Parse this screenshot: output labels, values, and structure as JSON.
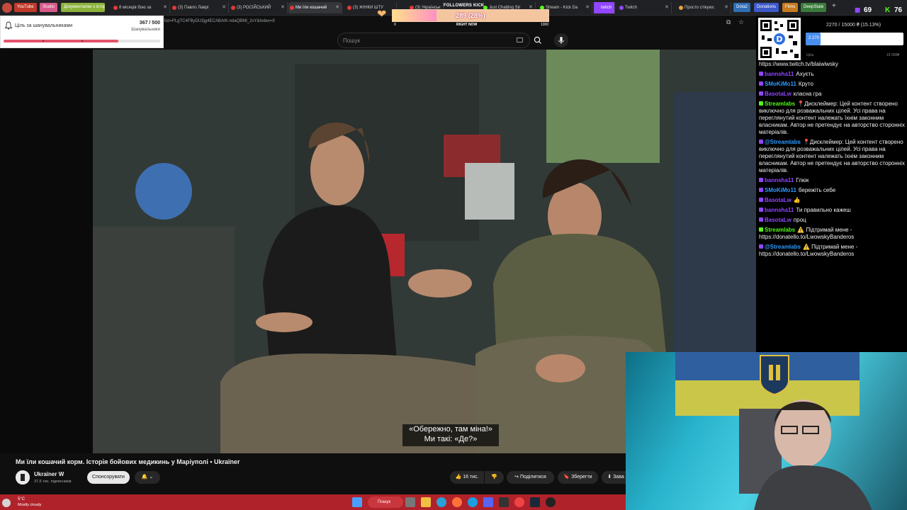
{
  "browser": {
    "bookmarks": [
      {
        "label": "YouTube",
        "color": "#c0392b"
      },
      {
        "label": "Studio",
        "color": "#d65a8a"
      },
      {
        "label": "Документалки з історії",
        "color": "#8bb23a"
      }
    ],
    "tabs": [
      {
        "label": "8 місяців бою за"
      },
      {
        "label": "(3) Павло Лаврі"
      },
      {
        "label": "(3) РОСІЙСЬКИЙ"
      },
      {
        "label": "Ми їли кошачий",
        "active": true
      },
      {
        "label": "(3) ЖІНКИ ШТУ"
      },
      {
        "label": "(3) Українськ"
      },
      {
        "label": "Just Chatting Str"
      },
      {
        "label": "Stream - Kick Da"
      },
      {
        "label": "twitch"
      },
      {
        "label": "Twitch"
      },
      {
        "label": "Просто стікуюс"
      },
      {
        "label": "Dota2"
      },
      {
        "label": "Donations"
      },
      {
        "label": "Films"
      },
      {
        "label": "DeepState"
      }
    ],
    "url": "list=PLgTC4FByDU3jg4ECABAIK-ndaQBMt_2sY&index=9",
    "viewers_left": "69",
    "viewers_right": "76"
  },
  "follower_goal": {
    "title": "Ціль за шанувальниками",
    "count": "367 / 500",
    "subtitle": "Шанувальники",
    "progress": 0.734
  },
  "kick_widget": {
    "label": "FOLLOWERS KICK",
    "value": "289 (28%)",
    "min": "0",
    "now": "RIGHT NOW",
    "max": "1000",
    "progress": 0.28
  },
  "youtube": {
    "search_placeholder": "Пошук",
    "subtitle_lines": [
      "«Обережно, там міна!»",
      "Ми такі: «Де?»"
    ],
    "video_title": "Ми їли кошачий корм. Історія бойових медикинь у Маріуполі • Ukraїner",
    "channel_name": "Ukraїner W",
    "channel_subs": "37,6 тис. підписників",
    "sponsor_label": "Спонсорувати",
    "likes": "16 тис.",
    "share_label": "Поділитися",
    "save_label": "Зберегти",
    "download_label": "Зава"
  },
  "donation_goal": {
    "text": "2270 / 15000 ₴ (15.13%)",
    "bar_label": "2 270",
    "min_label": "Ціль",
    "max_label": "15 000₴",
    "progress": 0.1513
  },
  "chat": {
    "messages": [
      {
        "user": "",
        "color": "#ffffff",
        "text": "https://www.twitch.tv/blaiwiwsky"
      },
      {
        "user": "bannsha11",
        "color": "#9146ff",
        "text": "Ахуєть"
      },
      {
        "user": "SMoKiMo11",
        "color": "#2e9bff",
        "text": "Круто"
      },
      {
        "user": "BasotaLw",
        "color": "#9146ff",
        "text": "класна гра"
      },
      {
        "user": "Streamlabs",
        "color": "#53fc18",
        "text": "📍Дисклеймер: Цей контент створено виключно для розважальних цілей. Усі права на переглянутий контент належать їхнім законним власникам. Автор не претендує на авторство сторонніх матеріалів."
      },
      {
        "user": "@Streamlabs",
        "color": "#2e9bff",
        "text": "📍Дисклеймер: Цей контент створено виключно для розважальних цілей. Усі права на переглянутий контент належать їхнім законним власникам. Автор не претендує на авторство сторонніх матеріалів."
      },
      {
        "user": "bannsha11",
        "color": "#9146ff",
        "text": "Глюк"
      },
      {
        "user": "SMoKiMo11",
        "color": "#2e9bff",
        "text": "бережіть себе"
      },
      {
        "user": "BasotaLw",
        "color": "#9146ff",
        "text": "👍"
      },
      {
        "user": "bannsha11",
        "color": "#9146ff",
        "text": "Ти правильно кажеш"
      },
      {
        "user": "BasotaLw",
        "color": "#9146ff",
        "text": "проц"
      },
      {
        "user": "Streamlabs",
        "color": "#53fc18",
        "text": "⚠️ Підтримай мене - https://donatello.to/LwowskyBanderos"
      },
      {
        "user": "@Streamlabs",
        "color": "#2e9bff",
        "text": "⚠️ Підтримай мене - https://donatello.to/LwowskyBanderos"
      }
    ]
  },
  "taskbar": {
    "temperature": "5°C",
    "weather": "Mostly cloudy",
    "search_label": "Пошук"
  }
}
